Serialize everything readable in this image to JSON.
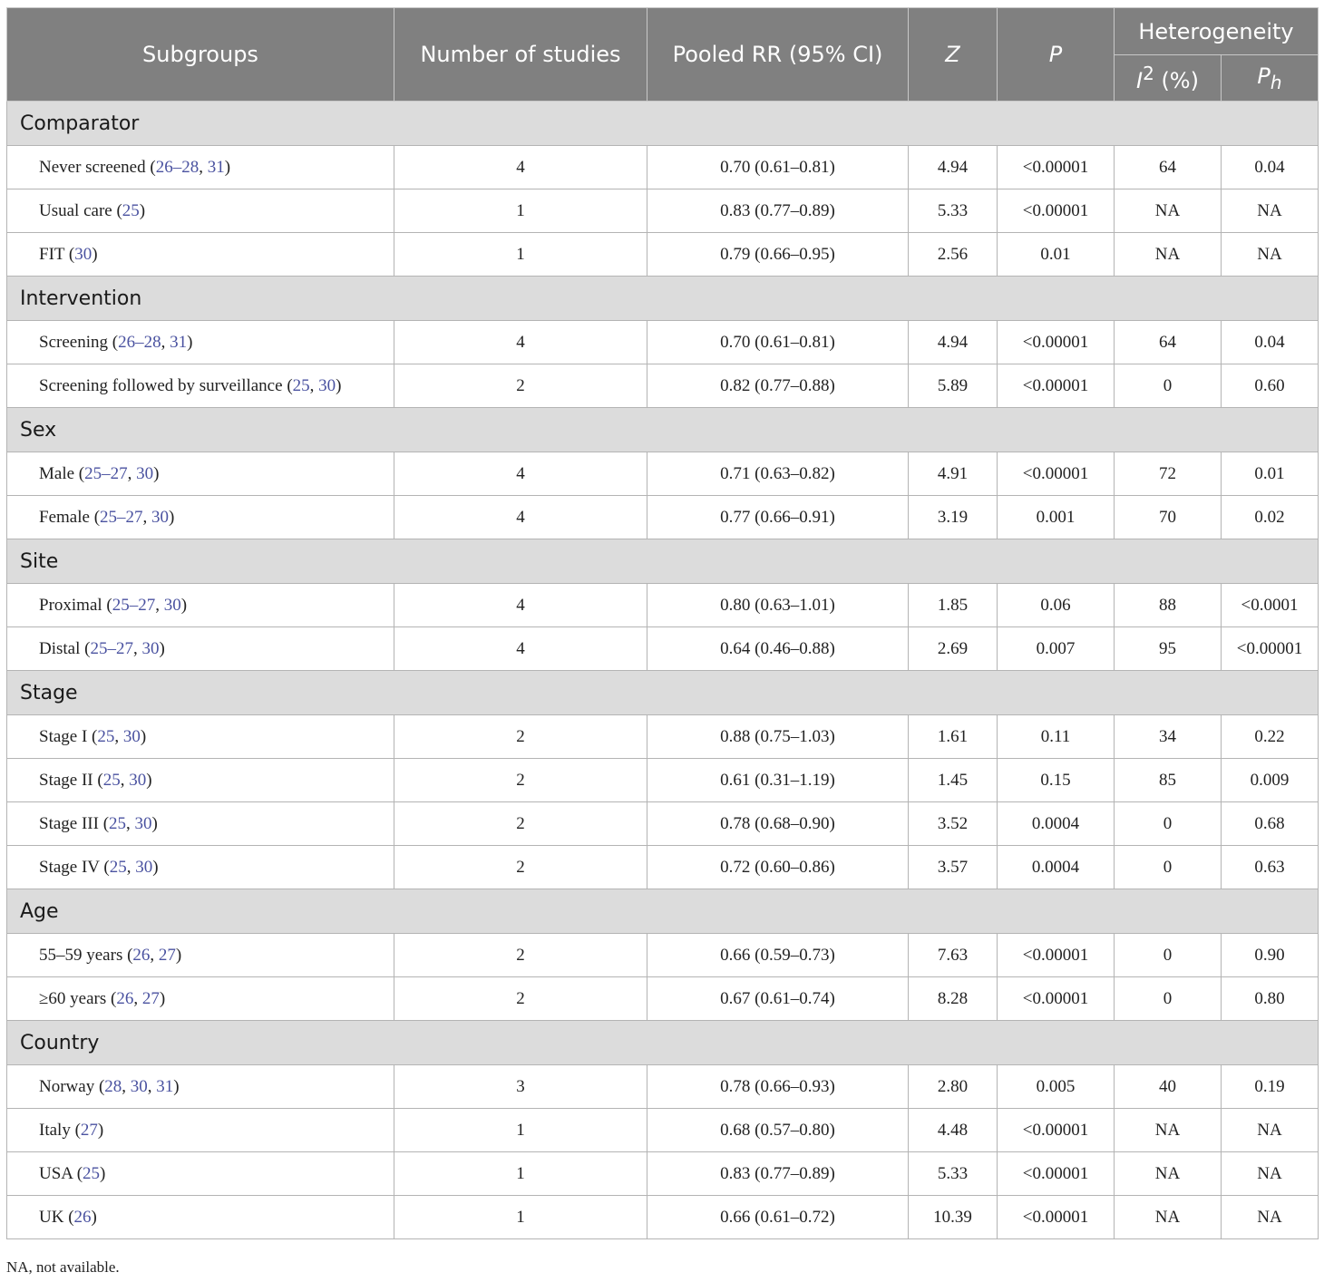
{
  "table": {
    "headers": {
      "subgroups": "Subgroups",
      "num_studies": "Number of studies",
      "pooled_rr": "Pooled RR (95% CI)",
      "z": "Z",
      "p": "P",
      "heterogeneity": "Heterogeneity",
      "i2_base": "I",
      "i2_sup": "2",
      "i2_suffix": " (%)",
      "ph_base": "P",
      "ph_sub": "h"
    },
    "groups": [
      {
        "title": "Comparator",
        "rows": [
          {
            "label": "Never screened",
            "refs": [
              "26–28",
              "31"
            ],
            "n": "4",
            "rr": "0.70 (0.61–0.81)",
            "z": "4.94",
            "p": "<0.00001",
            "i2": "64",
            "ph": "0.04"
          },
          {
            "label": "Usual care",
            "refs": [
              "25"
            ],
            "n": "1",
            "rr": "0.83 (0.77–0.89)",
            "z": "5.33",
            "p": "<0.00001",
            "i2": "NA",
            "ph": "NA"
          },
          {
            "label": "FIT",
            "refs": [
              "30"
            ],
            "n": "1",
            "rr": "0.79 (0.66–0.95)",
            "z": "2.56",
            "p": "0.01",
            "i2": "NA",
            "ph": "NA"
          }
        ]
      },
      {
        "title": "Intervention",
        "rows": [
          {
            "label": "Screening",
            "refs": [
              "26–28",
              "31"
            ],
            "n": "4",
            "rr": "0.70 (0.61–0.81)",
            "z": "4.94",
            "p": "<0.00001",
            "i2": "64",
            "ph": "0.04"
          },
          {
            "label": "Screening followed by surveillance",
            "refs": [
              "25",
              "30"
            ],
            "n": "2",
            "rr": "0.82 (0.77–0.88)",
            "z": "5.89",
            "p": "<0.00001",
            "i2": "0",
            "ph": "0.60"
          }
        ]
      },
      {
        "title": "Sex",
        "rows": [
          {
            "label": "Male",
            "refs": [
              "25–27",
              "30"
            ],
            "n": "4",
            "rr": "0.71 (0.63–0.82)",
            "z": "4.91",
            "p": "<0.00001",
            "i2": "72",
            "ph": "0.01"
          },
          {
            "label": "Female",
            "refs": [
              "25–27",
              "30"
            ],
            "n": "4",
            "rr": "0.77 (0.66–0.91)",
            "z": "3.19",
            "p": "0.001",
            "i2": "70",
            "ph": "0.02"
          }
        ]
      },
      {
        "title": "Site",
        "rows": [
          {
            "label": "Proximal",
            "refs": [
              "25–27",
              "30"
            ],
            "n": "4",
            "rr": "0.80 (0.63–1.01)",
            "z": "1.85",
            "p": "0.06",
            "i2": "88",
            "ph": "<0.0001"
          },
          {
            "label": "Distal",
            "refs": [
              "25–27",
              "30"
            ],
            "n": "4",
            "rr": "0.64 (0.46–0.88)",
            "z": "2.69",
            "p": "0.007",
            "i2": "95",
            "ph": "<0.00001"
          }
        ]
      },
      {
        "title": "Stage",
        "rows": [
          {
            "label": "Stage I",
            "refs": [
              "25",
              "30"
            ],
            "n": "2",
            "rr": "0.88 (0.75–1.03)",
            "z": "1.61",
            "p": "0.11",
            "i2": "34",
            "ph": "0.22"
          },
          {
            "label": "Stage II",
            "refs": [
              "25",
              "30"
            ],
            "n": "2",
            "rr": "0.61 (0.31–1.19)",
            "z": "1.45",
            "p": "0.15",
            "i2": "85",
            "ph": "0.009"
          },
          {
            "label": "Stage III",
            "refs": [
              "25",
              "30"
            ],
            "n": "2",
            "rr": "0.78 (0.68–0.90)",
            "z": "3.52",
            "p": "0.0004",
            "i2": "0",
            "ph": "0.68"
          },
          {
            "label": "Stage IV",
            "refs": [
              "25",
              "30"
            ],
            "n": "2",
            "rr": "0.72 (0.60–0.86)",
            "z": "3.57",
            "p": "0.0004",
            "i2": "0",
            "ph": "0.63"
          }
        ]
      },
      {
        "title": "Age",
        "rows": [
          {
            "label": "55–59 years",
            "refs": [
              "26",
              "27"
            ],
            "n": "2",
            "rr": "0.66 (0.59–0.73)",
            "z": "7.63",
            "p": "<0.00001",
            "i2": "0",
            "ph": "0.90"
          },
          {
            "label": "≥60 years",
            "refs": [
              "26",
              "27"
            ],
            "n": "2",
            "rr": "0.67 (0.61–0.74)",
            "z": "8.28",
            "p": "<0.00001",
            "i2": "0",
            "ph": "0.80"
          }
        ]
      },
      {
        "title": "Country",
        "rows": [
          {
            "label": "Norway",
            "refs": [
              "28",
              "30",
              "31"
            ],
            "n": "3",
            "rr": "0.78 (0.66–0.93)",
            "z": "2.80",
            "p": "0.005",
            "i2": "40",
            "ph": "0.19"
          },
          {
            "label": "Italy",
            "refs": [
              "27"
            ],
            "n": "1",
            "rr": "0.68 (0.57–0.80)",
            "z": "4.48",
            "p": "<0.00001",
            "i2": "NA",
            "ph": "NA"
          },
          {
            "label": "USA",
            "refs": [
              "25"
            ],
            "n": "1",
            "rr": "0.83 (0.77–0.89)",
            "z": "5.33",
            "p": "<0.00001",
            "i2": "NA",
            "ph": "NA"
          },
          {
            "label": "UK",
            "refs": [
              "26"
            ],
            "n": "1",
            "rr": "0.66 (0.61–0.72)",
            "z": "10.39",
            "p": "<0.00001",
            "i2": "NA",
            "ph": "NA"
          }
        ]
      }
    ]
  },
  "footnote": "NA, not available.",
  "colors": {
    "header_bg": "#808080",
    "group_bg": "#dcdcdc",
    "ref_link": "#4a52a0"
  }
}
